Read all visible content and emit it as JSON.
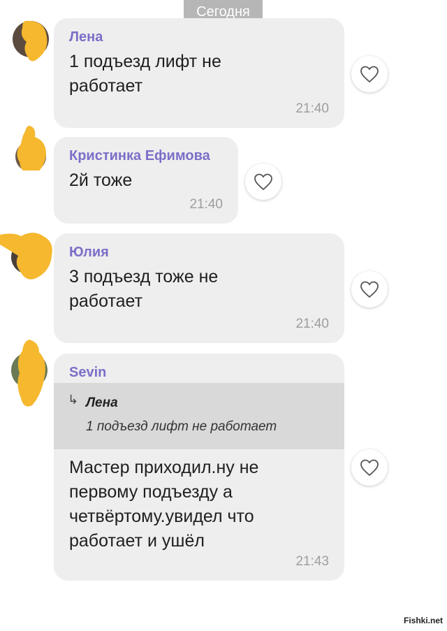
{
  "date_separator": "Сегодня",
  "messages": [
    {
      "sender": "Лена",
      "text": "1 подъезд лифт не\nработает",
      "time": "21:40"
    },
    {
      "sender": "Кристинка Ефимова",
      "text": "2й тоже",
      "time": "21:40"
    },
    {
      "sender": "Юлия",
      "text": "3 подъезд тоже не\nработает",
      "time": "21:40"
    },
    {
      "sender": "Sevin",
      "reply": {
        "name": "Лена",
        "text": "1 подъезд лифт не работает"
      },
      "text": "Мастер приходил.ну не\nпервому  подъезду а\nчетвёртому.увидел что\nработает  и ушёл",
      "time": "21:43"
    }
  ],
  "icons": {
    "like": "heart-outline-icon",
    "reply": "reply-arrow-icon"
  },
  "colors": {
    "sender_name": "#7b6fc8",
    "bubble": "#eeeeee",
    "reply_background": "#d9d9d9",
    "avatar_blur": "#f5b82e",
    "date_pill": "#b6b6b6"
  },
  "watermark": "Fishki.net"
}
